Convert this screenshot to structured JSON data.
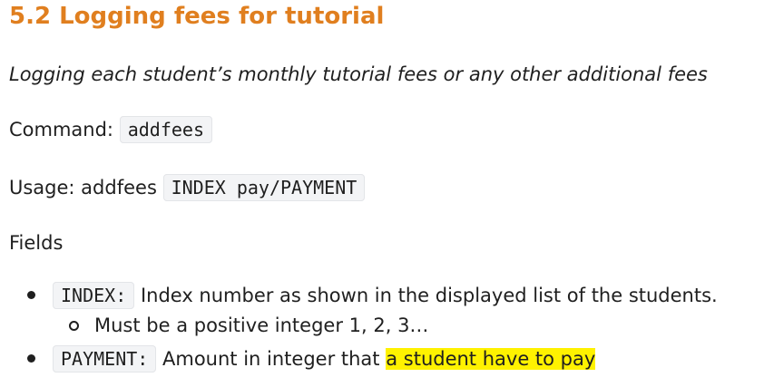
{
  "section": {
    "title": "5.2 Logging fees for tutorial"
  },
  "description": "Logging each student’s monthly tutorial fees or any other additional fees",
  "command": {
    "label": "Command:",
    "code": "addfees"
  },
  "usage": {
    "label": "Usage: addfees",
    "code": "INDEX pay/PAYMENT"
  },
  "fields": {
    "heading": "Fields",
    "items": [
      {
        "name": "INDEX:",
        "description": "Index number as shown in the displayed list of the students.",
        "sub_items": [
          "Must be a positive integer 1, 2, 3…"
        ]
      },
      {
        "name": "PAYMENT:",
        "description_plain": "Amount in integer that ",
        "description_highlighted": "a student have to pay"
      }
    ]
  },
  "colors": {
    "heading": "#e07f1f",
    "highlight": "#fff200",
    "code_background": "#f3f4f6"
  }
}
